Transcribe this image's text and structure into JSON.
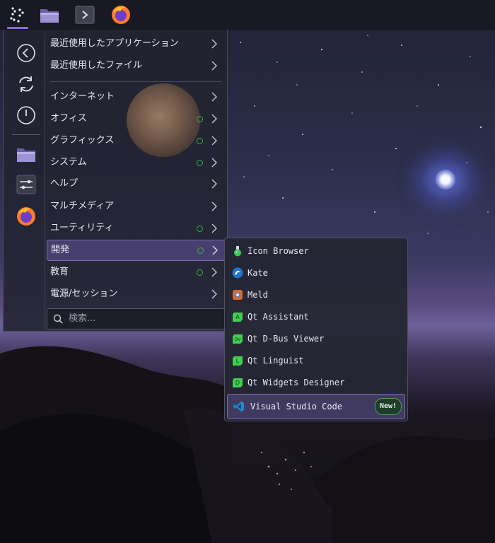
{
  "top_panel": {
    "launcher_icon": "kde-launcher-icon",
    "files_icon": "folder-icon",
    "terminal_icon": "terminal-icon",
    "browser_icon": "firefox-icon"
  },
  "sidebar": {
    "buttons": [
      {
        "icon": "back-icon"
      },
      {
        "icon": "refresh-icon"
      },
      {
        "icon": "power-icon"
      },
      {
        "icon": "folder-icon"
      },
      {
        "icon": "settings-sliders-icon"
      },
      {
        "icon": "firefox-icon"
      }
    ]
  },
  "menu": {
    "recent": [
      {
        "label": "最近使用したアプリケーション"
      },
      {
        "label": "最近使用したファイル"
      }
    ],
    "categories": [
      {
        "label": "インターネット",
        "dot": false
      },
      {
        "label": "オフィス",
        "dot": true
      },
      {
        "label": "グラフィックス",
        "dot": true
      },
      {
        "label": "システム",
        "dot": true
      },
      {
        "label": "ヘルプ",
        "dot": false
      },
      {
        "label": "マルチメディア",
        "dot": false
      },
      {
        "label": "ユーティリティ",
        "dot": true
      },
      {
        "label": "開発",
        "dot": true,
        "active": true
      },
      {
        "label": "教育",
        "dot": true
      },
      {
        "label": "電源/セッション",
        "dot": false
      }
    ],
    "search_placeholder": "検索..."
  },
  "submenu": {
    "apps": [
      {
        "name": "Icon Browser",
        "icon": "flask-icon"
      },
      {
        "name": "Kate",
        "icon": "kate-icon"
      },
      {
        "name": "Meld",
        "icon": "meld-icon"
      },
      {
        "name": "Qt Assistant",
        "icon": "qt-assistant-icon"
      },
      {
        "name": "Qt D-Bus Viewer",
        "icon": "qt-dbus-icon"
      },
      {
        "name": "Qt Linguist",
        "icon": "qt-linguist-icon"
      },
      {
        "name": "Qt Widgets Designer",
        "icon": "qt-designer-icon"
      },
      {
        "name": "Visual Studio Code",
        "icon": "vscode-icon",
        "badge": "New!",
        "active": true
      }
    ]
  },
  "colors": {
    "accent": "#7a6bb0",
    "status_dot": "#37b34a",
    "badge_border": "#46a05a"
  }
}
